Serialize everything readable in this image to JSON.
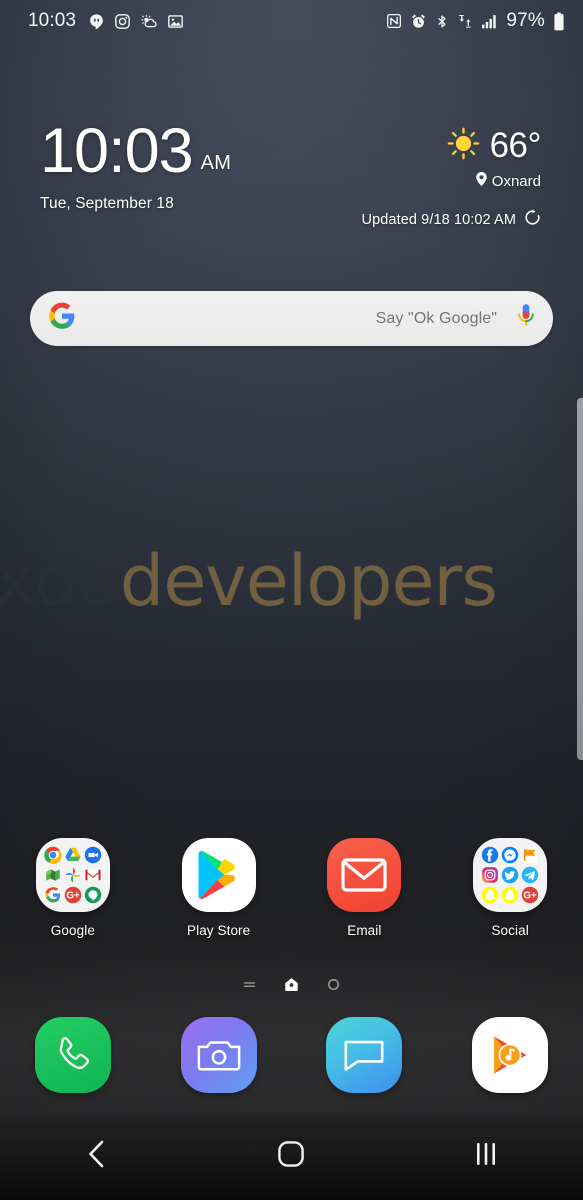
{
  "status_bar": {
    "time": "10:03",
    "battery_percent": "97%",
    "left_icons": [
      {
        "name": "hangouts-icon",
        "label": "Hangouts"
      },
      {
        "name": "instagram-icon",
        "label": "Instagram"
      },
      {
        "name": "weather-notification-icon",
        "label": "Weather"
      },
      {
        "name": "gallery-icon",
        "label": "Gallery"
      }
    ],
    "right_icons": [
      {
        "name": "nfc-icon",
        "label": "NFC"
      },
      {
        "name": "alarm-icon",
        "label": "Alarm"
      },
      {
        "name": "bluetooth-icon",
        "label": "Bluetooth"
      },
      {
        "name": "mobile-data-icon",
        "label": "Mobile data"
      },
      {
        "name": "signal-bars-icon",
        "label": "Signal"
      },
      {
        "name": "battery-icon",
        "label": "Battery"
      }
    ]
  },
  "clock_widget": {
    "time": "10:03",
    "meridiem": "AM",
    "date": "Tue, September 18"
  },
  "weather_widget": {
    "condition_icon": "sunny-icon",
    "temperature": "66°",
    "location": "Oxnard",
    "location_icon": "location-pin-icon",
    "updated": "Updated 9/18 10:02 AM",
    "refresh_icon": "refresh-icon"
  },
  "search": {
    "logo_icon": "google-g-icon",
    "placeholder": "Say \"Ok Google\"",
    "mic_icon": "microphone-icon"
  },
  "watermark": {
    "part1": "xda",
    "part2": "developers",
    "color1": "#2c303a",
    "color2": "#9c7f46"
  },
  "apps": [
    {
      "label": "Google",
      "type": "folder",
      "items": [
        "Chrome",
        "Drive",
        "Duo",
        "Maps",
        "Photos",
        "Gmail",
        "Google",
        "Google+",
        "Hangouts"
      ]
    },
    {
      "label": "Play Store",
      "type": "app",
      "icon": "play-store-icon"
    },
    {
      "label": "Email",
      "type": "app",
      "icon": "email-icon",
      "color": "#f4523b"
    },
    {
      "label": "Social",
      "type": "folder",
      "items": [
        "Facebook",
        "Messenger",
        "Flag",
        "Instagram",
        "Twitter",
        "Telegram",
        "Snapchat",
        "Snapchat",
        "Google+"
      ]
    }
  ],
  "page_indicator": {
    "pages": [
      {
        "name": "page-dot-list",
        "active": false
      },
      {
        "name": "page-dot-home",
        "active": true
      },
      {
        "name": "page-dot-circle",
        "active": false
      }
    ]
  },
  "dock": [
    {
      "label": "Phone",
      "icon": "phone-icon",
      "color": "#1ec05a"
    },
    {
      "label": "Camera",
      "icon": "camera-icon",
      "color": "#7b6cf0"
    },
    {
      "label": "Messages",
      "icon": "messages-icon",
      "color": "#3fc5e0"
    },
    {
      "label": "Play Music",
      "icon": "play-music-icon",
      "color": "#ffffff"
    }
  ],
  "nav_bar": [
    {
      "name": "back-button",
      "icon": "chevron-left-icon"
    },
    {
      "name": "home-button",
      "icon": "home-square-icon"
    },
    {
      "name": "recents-button",
      "icon": "recents-bars-icon"
    }
  ]
}
